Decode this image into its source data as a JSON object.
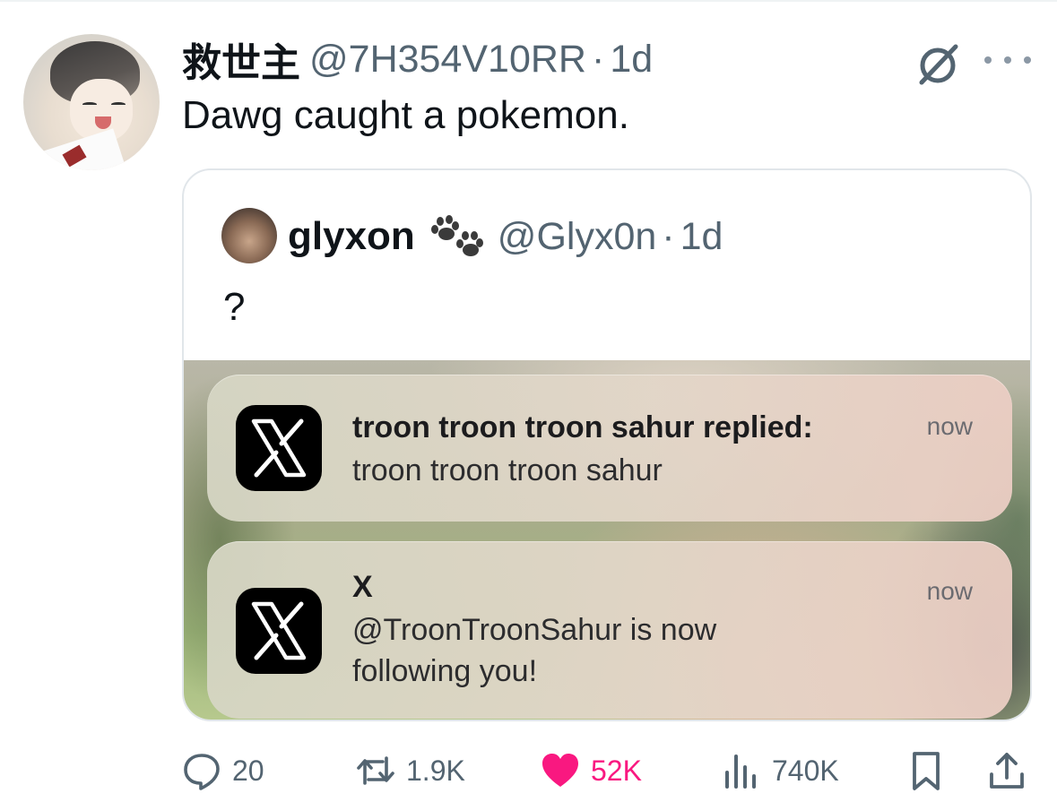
{
  "tweet": {
    "author_name": "救世主",
    "author_handle": "@7H354V10RR",
    "separator": "·",
    "time": "1d",
    "text": "Dawg caught a pokemon."
  },
  "quoted_tweet": {
    "author_name": "glyxon",
    "author_handle": "@Glyx0n",
    "separator": "·",
    "time": "1d",
    "text": "?",
    "notifications": [
      {
        "title": "troon troon troon sahur replied:",
        "body_lines": [
          "troon troon troon sahur"
        ],
        "time": "now",
        "app_icon": "x-logo-icon"
      },
      {
        "title": "X",
        "body_lines": [
          "@TroonTroonSahur is now",
          "following you!"
        ],
        "time": "now",
        "app_icon": "x-logo-icon"
      }
    ]
  },
  "actions": {
    "replies": "20",
    "reposts": "1.9K",
    "likes": "52K",
    "views": "740K"
  },
  "colors": {
    "text_primary": "#0f1419",
    "text_secondary": "#536471",
    "like_active": "#f91880",
    "border": "#e1e6ea"
  },
  "icons": [
    "grok-icon",
    "more-icon",
    "paw-emoji-icon",
    "reply-icon",
    "repost-icon",
    "like-icon",
    "views-icon",
    "bookmark-icon",
    "share-icon"
  ]
}
